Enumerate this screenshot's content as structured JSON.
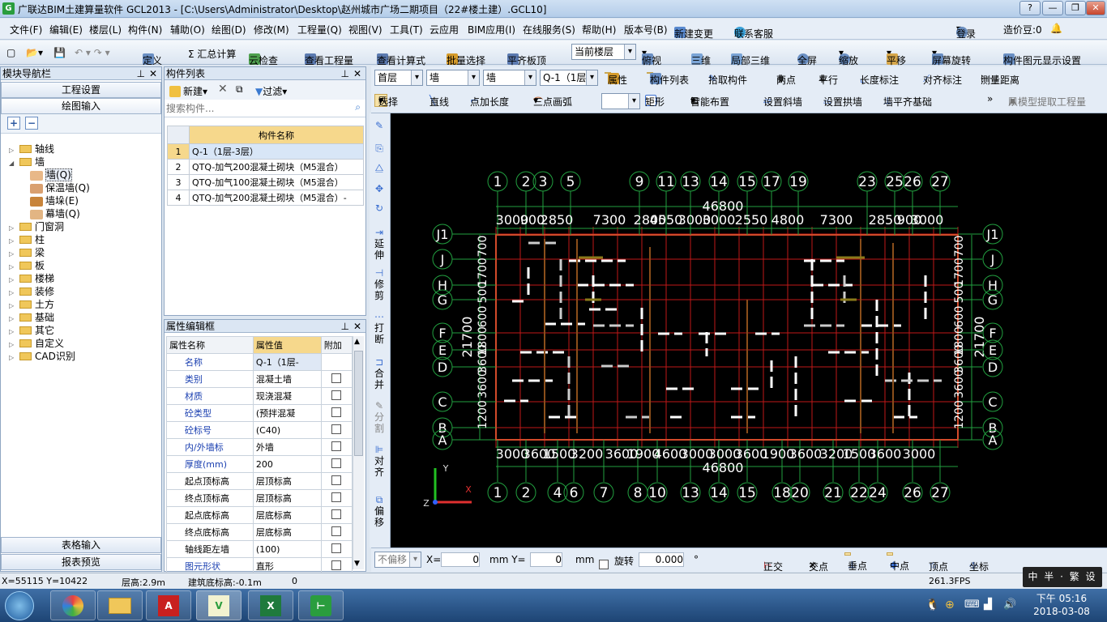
{
  "title": "广联达BIM土建算量软件 GCL2013 - [C:\\Users\\Administrator\\Desktop\\赵州城市广场二期项目（22#楼土建）.GCL10]",
  "window_buttons": [
    "?",
    "—",
    "❐",
    "✕"
  ],
  "menu": [
    "文件(F)",
    "编辑(E)",
    "楼层(L)",
    "构件(N)",
    "辅助(O)",
    "绘图(D)",
    "修改(M)",
    "工程量(Q)",
    "视图(V)",
    "工具(T)",
    "云应用",
    "BIM应用(I)",
    "在线服务(S)",
    "帮助(H)",
    "版本号(B)",
    "新建变更",
    "联系客服"
  ],
  "menu_right": {
    "login": "登录",
    "score": "造价豆:0"
  },
  "toolbar": [
    "定义",
    "Σ 汇总计算",
    "云检查",
    "查看工程量",
    "查看计算式",
    "批量选择",
    "平齐板顶",
    "当前楼层",
    "俯视",
    "三维",
    "局部三维",
    "全屏",
    "缩放",
    "平移",
    "屏幕旋转",
    "构件图元显示设置"
  ],
  "nav": {
    "title": "模块导航栏",
    "btn1": "工程设置",
    "btn2": "绘图输入",
    "btn3": "表格输入",
    "btn4": "报表预览",
    "tree": [
      "轴线",
      "墙",
      "墙(Q)",
      "保温墙(Q)",
      "墙垛(E)",
      "幕墙(Q)",
      "门窗洞",
      "柱",
      "梁",
      "板",
      "楼梯",
      "装修",
      "土方",
      "基础",
      "其它",
      "自定义",
      "CAD识别"
    ]
  },
  "clist": {
    "title": "构件列表",
    "new": "新建",
    "filter": "过滤",
    "search_placeholder": "搜索构件...",
    "header": "构件名称",
    "rows": [
      [
        "1",
        "Q-1（1层-3层）"
      ],
      [
        "2",
        "QTQ-加气200混凝土砌块（M5混合）"
      ],
      [
        "3",
        "QTQ-加气100混凝土砌块（M5混合）"
      ],
      [
        "4",
        "QTQ-加气200混凝土砌块（M5混合）-"
      ]
    ]
  },
  "props": {
    "title": "属性编辑框",
    "h1": "属性名称",
    "h2": "属性值",
    "h3": "附加",
    "rows": [
      [
        "名称",
        "Q-1（1层-"
      ],
      [
        "类别",
        "混凝土墙"
      ],
      [
        "材质",
        "现浇混凝"
      ],
      [
        "砼类型",
        "(预拌混凝"
      ],
      [
        "砼标号",
        "(C40)"
      ],
      [
        "内/外墙标",
        "外墙"
      ],
      [
        "厚度(mm)",
        "200"
      ],
      [
        "起点顶标高",
        "层顶标高"
      ],
      [
        "终点顶标高",
        "层顶标高"
      ],
      [
        "起点底标高",
        "层底标高"
      ],
      [
        "终点底标高",
        "层底标高"
      ],
      [
        "轴线距左墙",
        "(100)"
      ],
      [
        "图元形状",
        "直形"
      ]
    ]
  },
  "draw_toolbar": {
    "floor": "首层",
    "type1": "墙",
    "type2": "墙",
    "item": "Q-1（1层",
    "attr": "属性",
    "list": "构件列表",
    "pick": "拾取构件",
    "two_point": "两点",
    "parallel": "平行",
    "len_mark": "长度标注",
    "align_mark": "对齐标注",
    "measure": "测量距离",
    "select": "选择",
    "line": "直线",
    "pt_len": "点加长度",
    "arc3": "三点画弧",
    "rect": "矩形",
    "smart": "智能布置",
    "slope": "设置斜墙",
    "arch": "设置拱墙",
    "flush": "墙平齐基础",
    "extract": "从模型提取工程量"
  },
  "vtools": [
    "延伸",
    "修剪",
    "打断",
    "合并",
    "分割",
    "对齐",
    "偏移"
  ],
  "canvas": {
    "top_axes": [
      "1",
      "2",
      "3",
      "5",
      "9",
      "11",
      "13",
      "14",
      "15",
      "17",
      "19",
      "23",
      "25",
      "26",
      "27"
    ],
    "bottom_axes": [
      "1",
      "2",
      "4",
      "6",
      "7",
      "8",
      "10",
      "13",
      "14",
      "15",
      "18",
      "20",
      "21",
      "22",
      "24",
      "26",
      "27"
    ],
    "left_axes": [
      "J1",
      "J",
      "H",
      "G",
      "F",
      "E",
      "D",
      "C",
      "B",
      "A"
    ],
    "total_width": "46800",
    "total_height": "21700",
    "top_dims": [
      "3000",
      "900",
      "2850",
      "7300",
      "2800",
      "4550",
      "3000",
      "3000",
      "2550",
      "4800",
      "7300",
      "2850",
      "900",
      "3000"
    ],
    "bottom_dims": [
      "3000",
      "3600",
      "1500",
      "3200",
      "3600",
      "1900",
      "4600",
      "3000",
      "3000",
      "3600",
      "1900",
      "3600",
      "3200",
      "1500",
      "3600",
      "3000"
    ],
    "left_dims": [
      "700",
      "1700",
      "500",
      "600",
      "1800",
      "3600",
      "3600",
      "1200"
    ],
    "axis_x": "X",
    "axis_y": "Y",
    "axis_z": "Z"
  },
  "bottom": {
    "offset": "不偏移",
    "x_label": "X=",
    "x_val": "0",
    "y_label": "mm Y=",
    "y_val": "0",
    "unit": "mm",
    "rotate": "旋转",
    "rot_val": "0.000",
    "deg": "°",
    "ortho": "正交",
    "cross": "交点",
    "perp": "垂点",
    "mid": "中点",
    "vertex": "顶点",
    "coord": "坐标"
  },
  "status": {
    "coords": "X=55115 Y=10422",
    "floor_h": "层高:2.9m",
    "base_h": "建筑底标高:-0.1m",
    "zero": "0",
    "fps": "261.3FPS"
  },
  "ime": "中 半 · 繁 设",
  "clock": {
    "time": "下午 05:16",
    "date": "2018-03-08"
  }
}
